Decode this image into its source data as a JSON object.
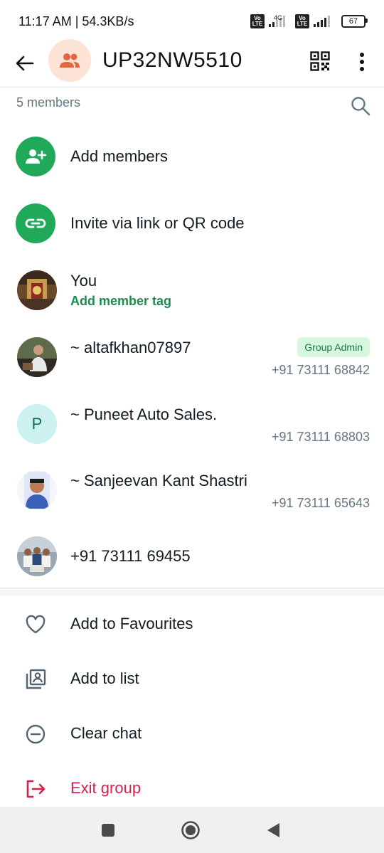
{
  "status_bar": {
    "time_speed": "11:17 AM | 54.3KB/s",
    "volte_1": "Vo LTE",
    "network_type": "4G",
    "volte_2": "Vo LTE",
    "battery": "67"
  },
  "header": {
    "title": "UP32NW5510",
    "back_icon": "arrow-left-icon",
    "avatar_icon": "group-icon",
    "qr_icon": "qr-code-icon",
    "menu_icon": "more-vertical-icon"
  },
  "members": {
    "count_label": "5 members",
    "search_icon": "search-icon"
  },
  "actions": [
    {
      "label": "Add members",
      "icon": "add-person-icon"
    },
    {
      "label": "Invite via link or QR code",
      "icon": "link-icon"
    }
  ],
  "member_list": [
    {
      "name": "You",
      "subtitle": "Add member tag",
      "avatar": "temple-photo"
    },
    {
      "name": "~ altafkhan07897",
      "badge": "Group Admin",
      "phone": "+91 73111 68842",
      "avatar": "person-photo"
    },
    {
      "name": "~ Puneet Auto Sales.",
      "phone": "+91 73111 68803",
      "avatar_letter": "P"
    },
    {
      "name": "~ Sanjeevan Kant Shastri",
      "phone": "+91 73111 65643",
      "avatar": "portrait-photo"
    },
    {
      "name": "+91 73111 69455",
      "avatar": "group-photo"
    }
  ],
  "options": [
    {
      "label": "Add to Favourites",
      "icon": "heart-icon"
    },
    {
      "label": "Add to list",
      "icon": "contact-list-icon"
    },
    {
      "label": "Clear chat",
      "icon": "minus-circle-icon"
    },
    {
      "label": "Exit group",
      "icon": "exit-icon"
    }
  ],
  "colors": {
    "accent_green": "#21a95a",
    "danger": "#d5224d",
    "admin_badge_bg": "#d8f7df"
  }
}
